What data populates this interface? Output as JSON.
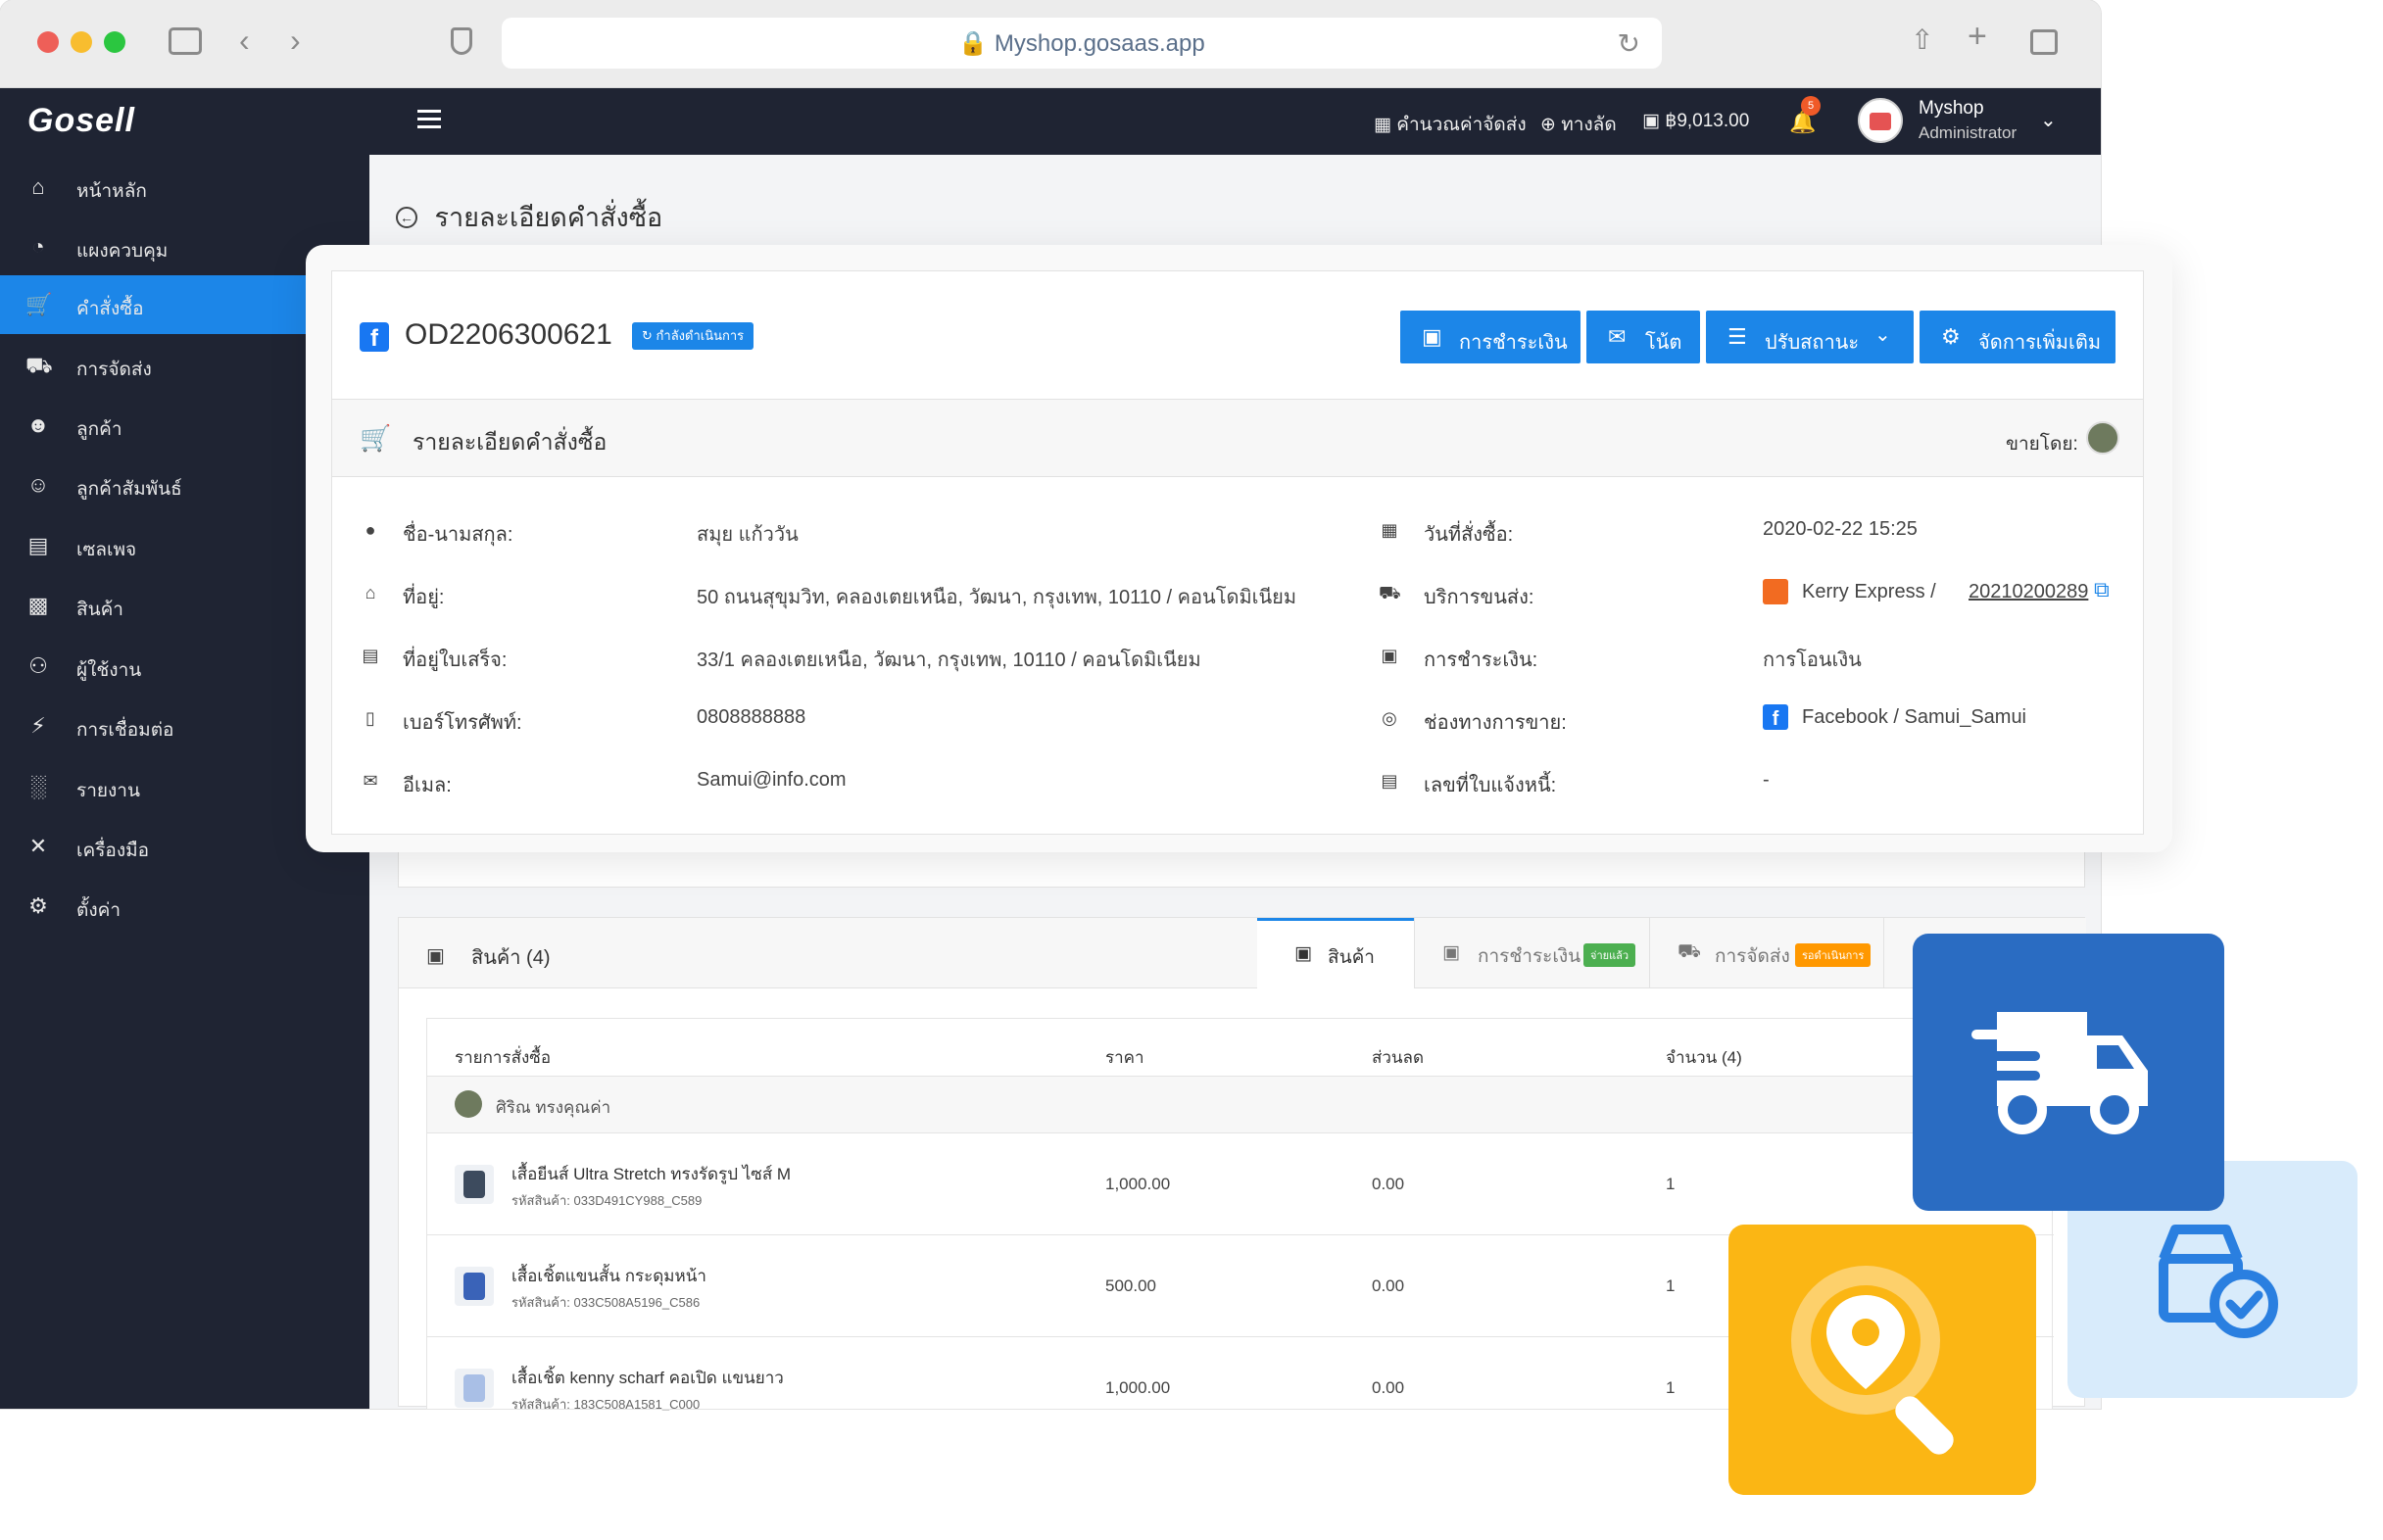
{
  "browser": {
    "url": "Myshop.gosaas.app",
    "traffic_colors": [
      "#ee5f58",
      "#f8bd2f",
      "#2bc640"
    ]
  },
  "topbar": {
    "logo": "Gosell",
    "calculator_label": "คำนวณค่าจัดส่ง",
    "shortcut_label": "ทางลัด",
    "balance": "฿9,013.00",
    "notif_count": "5",
    "user_name": "Myshop",
    "user_role": "Administrator"
  },
  "sidebar": {
    "items": [
      {
        "label": "หน้าหลัก",
        "icon": "home-icon"
      },
      {
        "label": "แผงควบคุม",
        "icon": "dashboard-icon"
      },
      {
        "label": "คำสั่งซื้อ",
        "icon": "cart-icon"
      },
      {
        "label": "การจัดส่ง",
        "icon": "truck-icon"
      },
      {
        "label": "ลูกค้า",
        "icon": "users-icon"
      },
      {
        "label": "ลูกค้าสัมพันธ์",
        "icon": "crm-icon"
      },
      {
        "label": "เซลเพจ",
        "icon": "salepage-icon"
      },
      {
        "label": "สินค้า",
        "icon": "product-icon"
      },
      {
        "label": "ผู้ใช้งาน",
        "icon": "staff-icon"
      },
      {
        "label": "การเชื่อมต่อ",
        "icon": "plug-icon"
      },
      {
        "label": "รายงาน",
        "icon": "report-icon"
      },
      {
        "label": "เครื่องมือ",
        "icon": "tools-icon"
      },
      {
        "label": "ตั้งค่า",
        "icon": "settings-icon"
      }
    ],
    "active_index": 2
  },
  "page": {
    "title": "รายละเอียดคำสั่งซื้อ"
  },
  "order": {
    "id": "OD2206300621",
    "status_badge": "กำลังดำเนินการ",
    "buttons": {
      "payment": "การชำระเงิน",
      "note": "โน้ต",
      "status": "ปรับสถานะ",
      "more": "จัดการเพิ่มเติม"
    },
    "detail_heading": "รายละเอียดคำสั่งซื้อ",
    "sold_by_label": "ขายโดย:",
    "left": [
      {
        "label": "ชื่อ-นามสกุล:",
        "value": "สมุย แก้ววัน"
      },
      {
        "label": "ที่อยู่:",
        "value": "50 ถนนสุขุมวิท, คลองเตยเหนือ, วัฒนา, กรุงเทพ, 10110 / คอนโดมิเนียม"
      },
      {
        "label": "ที่อยู่ใบเสร็จ:",
        "value": "33/1 คลองเตยเหนือ, วัฒนา, กรุงเทพ, 10110 / คอนโดมิเนียม"
      },
      {
        "label": "เบอร์โทรศัพท์:",
        "value": "0808888888"
      },
      {
        "label": "อีเมล:",
        "value": "Samui@info.com"
      }
    ],
    "right": {
      "order_date_label": "วันที่สั่งซื้อ:",
      "order_date": "2020-02-22 15:25",
      "shipping_label": "บริการขนส่ง:",
      "shipping_carrier": "Kerry Express /",
      "tracking_no": "20210200289",
      "payment_label": "การชำระเงิน:",
      "payment_method": "การโอนเงิน",
      "channel_label": "ช่องทางการขาย:",
      "channel": "Facebook / Samui_Samui",
      "invoice_label": "เลขที่ใบแจ้งหนี้:",
      "invoice": "-"
    }
  },
  "products": {
    "panel_title": "สินค้า (4)",
    "tabs": {
      "products": "สินค้า",
      "payment": "การชำระเงิน",
      "payment_badge": "จ่ายแล้ว",
      "shipping": "การจัดส่ง",
      "shipping_badge": "รอดำเนินการ"
    },
    "columns": {
      "item": "รายการสั่งซื้อ",
      "price": "ราคา",
      "discount": "ส่วนลด",
      "qty": "จำนวน (4)"
    },
    "seller": "ศิริณ ทรงคุณค่า",
    "rows": [
      {
        "name": "เสื้อยีนส์ Ultra Stretch ทรงรัดรูป ไซส์ M",
        "sku": "รหัสสินค้า: 033D491CY988_C589",
        "price": "1,000.00",
        "discount": "0.00",
        "qty": "1"
      },
      {
        "name": "เสื้อเชิ้ตแขนสั้น กระดุมหน้า",
        "sku": "รหัสสินค้า: 033C508A5196_C586",
        "price": "500.00",
        "discount": "0.00",
        "qty": "1"
      },
      {
        "name": "เสื้อเชิ้ต kenny scharf คอเปิด แขนยาว",
        "sku": "รหัสสินค้า: 183C508A1581_C000",
        "price": "1,000.00",
        "discount": "0.00",
        "qty": "1"
      }
    ]
  },
  "colors": {
    "nav_bg": "#1f2433",
    "primary": "#1c86e8",
    "paid_badge": "#4caf50",
    "pending_badge": "#ff9800",
    "tile_blue": "#2a6cc2",
    "tile_light": "#d8ebfb",
    "tile_yellow": "#fbb614"
  }
}
